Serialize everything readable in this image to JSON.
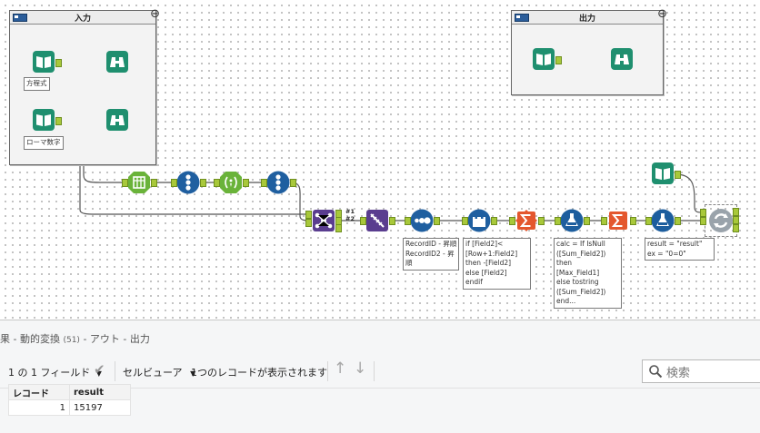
{
  "containers": {
    "input": {
      "title": "入力"
    },
    "output": {
      "title": "出力"
    }
  },
  "tools": [
    {
      "name": "input-data-tool",
      "icon": "book-icon"
    },
    {
      "name": "browse-tool",
      "icon": "binoculars-icon"
    },
    {
      "name": "text-to-columns-tool",
      "icon": "columns-icon"
    },
    {
      "name": "record-id-tool",
      "icon": "numbers-icon"
    },
    {
      "name": "regex-tool",
      "icon": "regex-icon"
    },
    {
      "name": "join-multiple-tool",
      "icon": "network-icon"
    },
    {
      "name": "dynamic-rename-tool",
      "icon": "chain-icon"
    },
    {
      "name": "sort-tool",
      "icon": "dots-icon"
    },
    {
      "name": "multi-row-formula-tool",
      "icon": "castle-icon"
    },
    {
      "name": "summarize-tool",
      "icon": "sigma-icon"
    },
    {
      "name": "formula-tool",
      "icon": "flask-icon"
    },
    {
      "name": "test-tool",
      "icon": "refresh-icon"
    }
  ],
  "labels": {
    "equation": "方程式",
    "roman": "ローマ数字",
    "join_anchor1": "#1",
    "join_anchor2": "#2",
    "sort_note": "RecordID - 昇順\nRecordID2 - 昇\n順",
    "multirow_note": "if [Field2]<\n[Row+1:Field2]\nthen -[Field2]\nelse [Field2]\nendif",
    "formula1_note": "calc = If IsNull\n([Sum_Field2])\nthen\n[Max_Field1]\nelse tostring\n([Sum_Field2])\nend...",
    "formula2_note": "result = \"result\"\nex = \"0=0\""
  },
  "results": {
    "title": "果 - 動的変換",
    "tool_id": "(51)",
    "title_rest": " - アウト - 出力",
    "field_selector": "1 の 1 フィールド",
    "cell_viewer": "セルビューア",
    "record_status": "1つのレコードが表示されます",
    "search_placeholder": "検索",
    "columns": [
      "レコード",
      "result"
    ],
    "rows": [
      {
        "record": "1",
        "value": "15197"
      }
    ]
  },
  "colors": {
    "input_green": "#1f8f6f",
    "prep_green": "#6ab33a",
    "parse_blue": "#1f5fa0",
    "join_purple": "#5a3d8f",
    "transform_orange": "#e4572e",
    "formula_blue": "#1d5e9e",
    "anchor_green": "#a8c83a"
  }
}
